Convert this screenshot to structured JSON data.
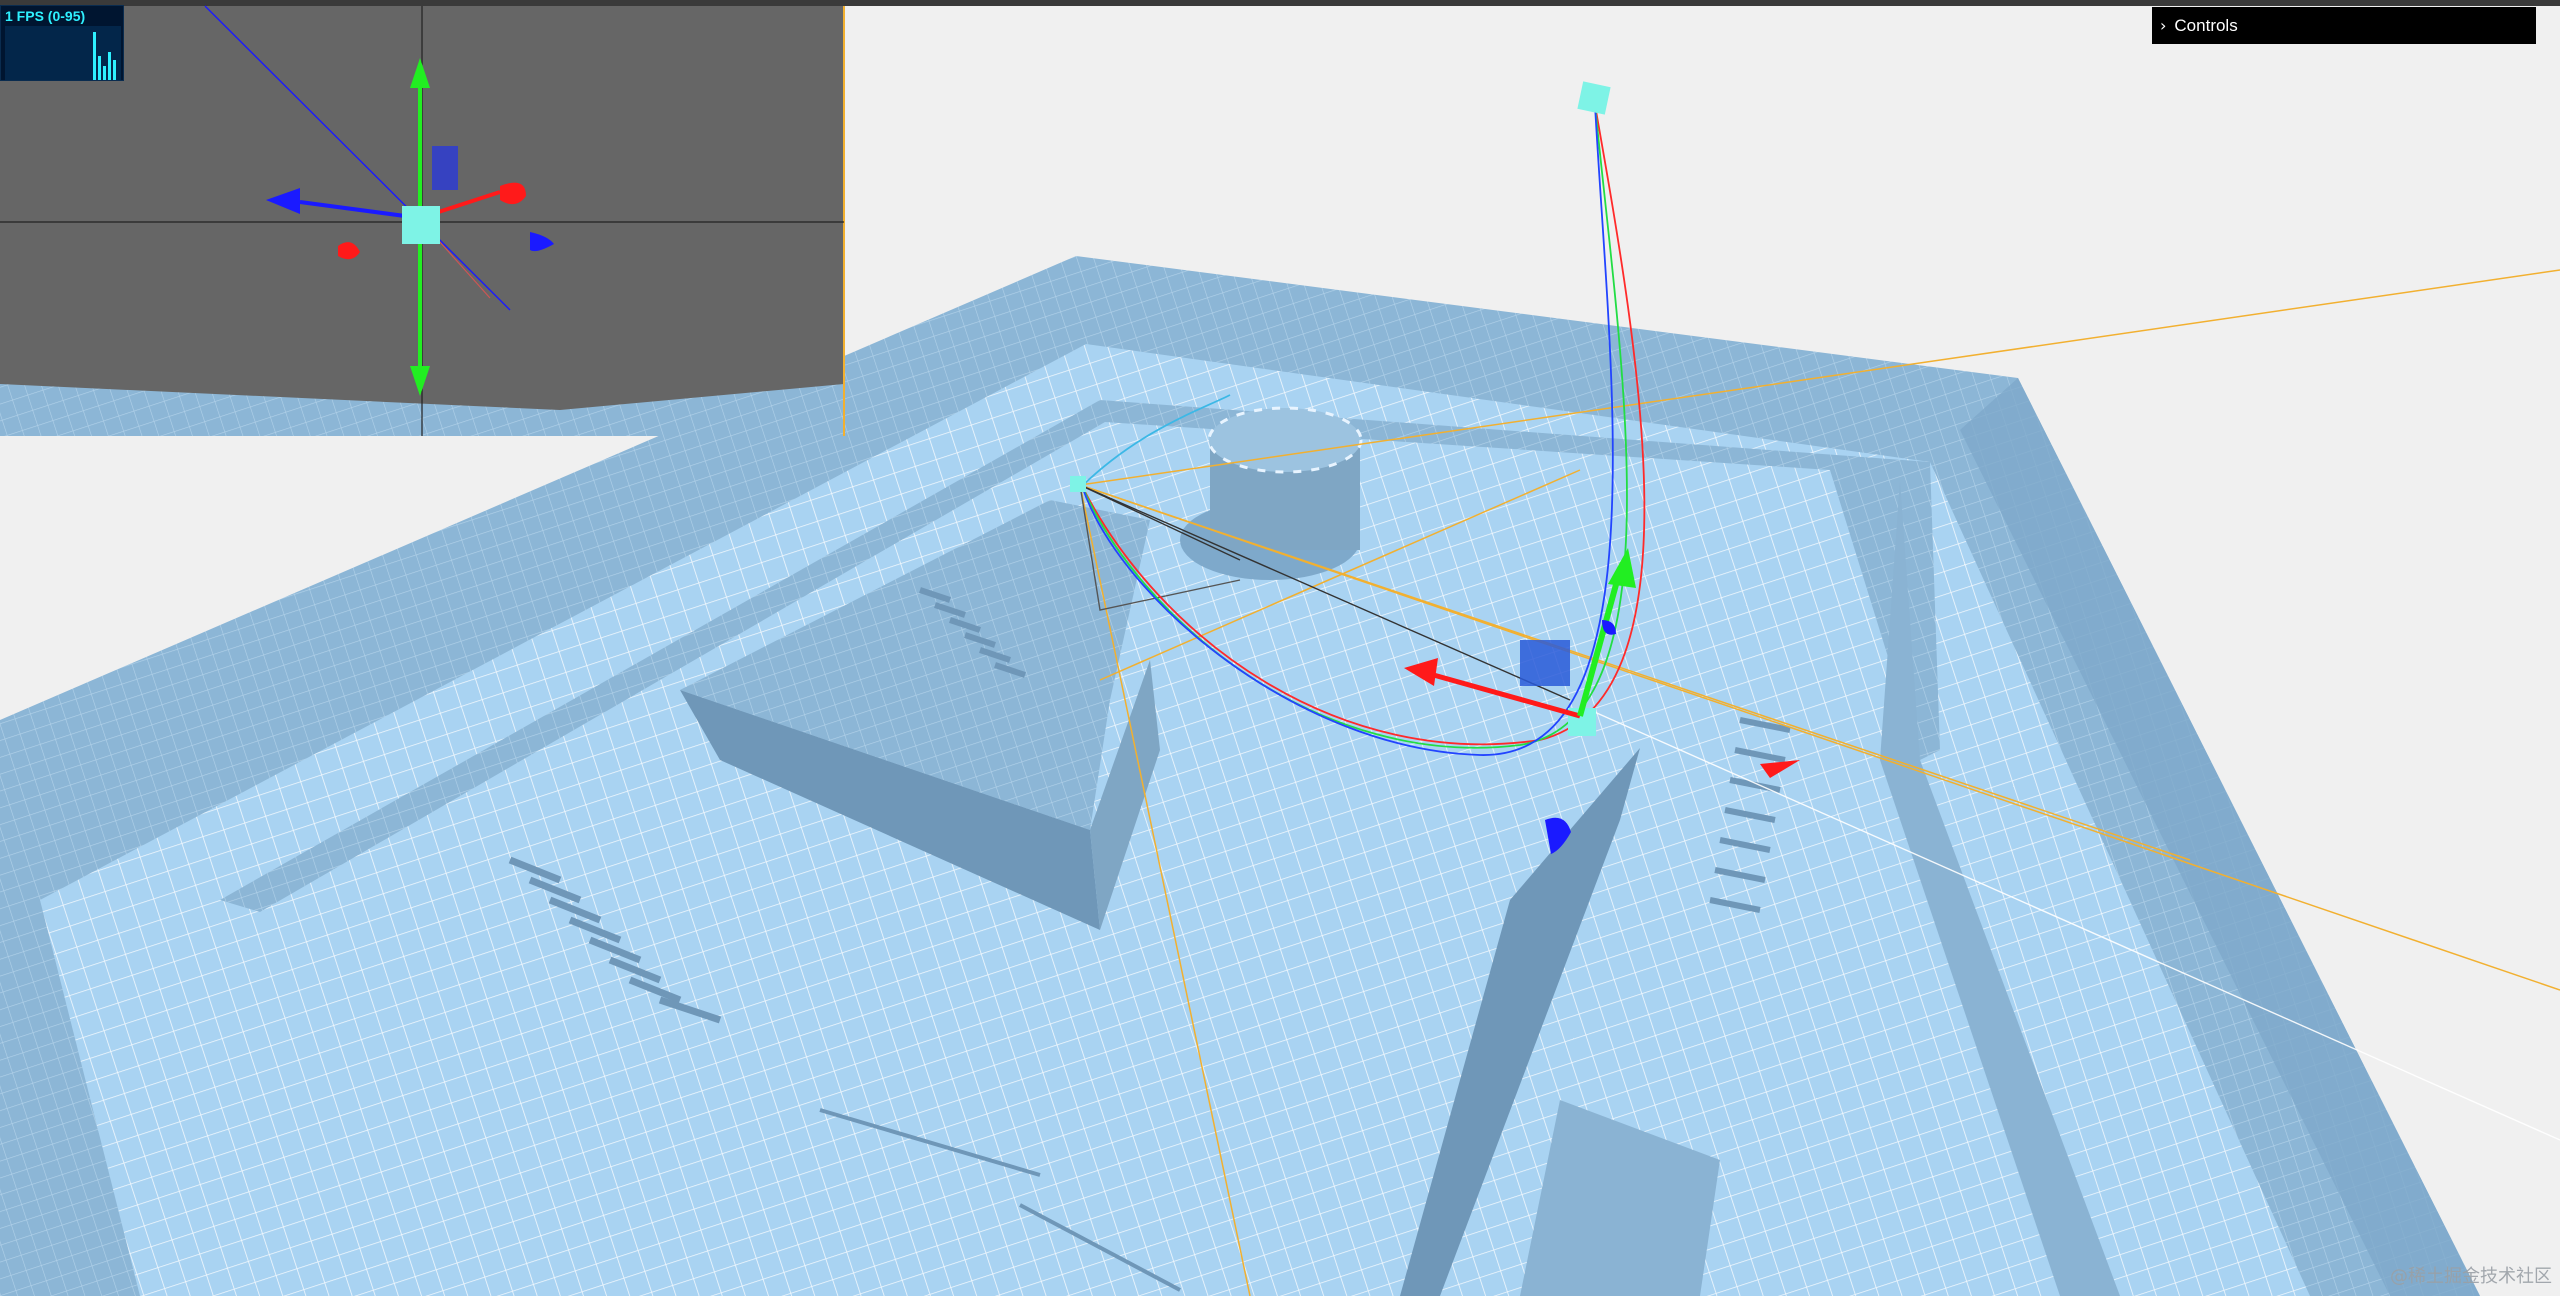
{
  "stats": {
    "label": "1 FPS (0-95)",
    "bars": [
      0.05,
      0.12,
      0.08,
      0.6,
      0.9,
      0.4,
      0.3
    ]
  },
  "controls": {
    "title": "Controls",
    "chevron": "chevron-right-icon"
  },
  "watermark": {
    "text": "@稀土掘金技术社区"
  },
  "colors": {
    "background": "#f0f0f0",
    "floor": "#a9d3f2",
    "wall_top": "#8fb8d8",
    "wall_side": "#6f97b8",
    "inset_view": "#666666",
    "axis_x": "#ff1a1a",
    "axis_y": "#22ee22",
    "axis_z": "#1a1aff",
    "camera_line": "#f2b030",
    "marker": "#7ef3e6"
  }
}
